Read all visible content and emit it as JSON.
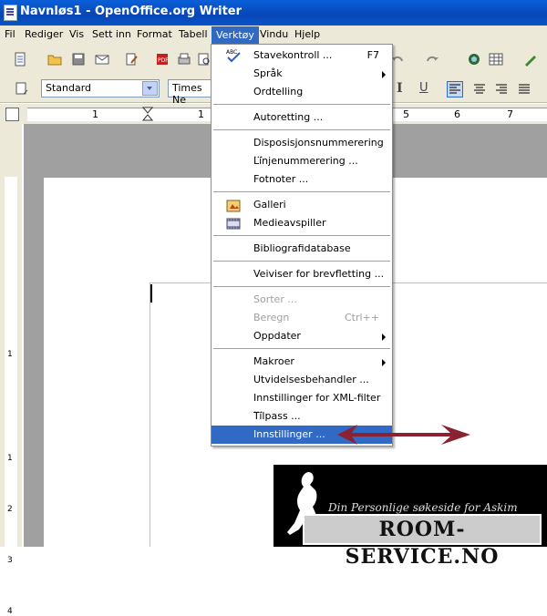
{
  "window": {
    "title": "Navnløs1 - OpenOffice.org Writer"
  },
  "menubar": {
    "items": [
      "Fil",
      "Rediger",
      "Vis",
      "Sett inn",
      "Format",
      "Tabell",
      "Verktøy",
      "Vindu",
      "Hjelp"
    ],
    "active_index": 6
  },
  "formatting": {
    "style_value": "Standard",
    "font_value": "Times Ne"
  },
  "ruler": {
    "h_labels": [
      "1",
      "1",
      "5",
      "6",
      "7"
    ],
    "v_labels": [
      "1",
      "1",
      "2",
      "3",
      "4"
    ]
  },
  "tools_menu": {
    "items": [
      {
        "label": "Stavekontroll ...",
        "accel": "F7",
        "icon": "spellcheck-icon"
      },
      {
        "label": "Språk",
        "submenu": true
      },
      {
        "label": "Ordtelling"
      },
      {
        "label": "Autoretting ..."
      },
      {
        "label": "Disposisjonsnummerering ..."
      },
      {
        "label": "Linjenummerering ..."
      },
      {
        "label": "Fotnoter ..."
      },
      {
        "label": "Galleri",
        "icon": "gallery-icon"
      },
      {
        "label": "Medieavspiller",
        "icon": "media-player-icon"
      },
      {
        "label": "Bibliografidatabase"
      },
      {
        "label": "Veiviser for brevfletting ..."
      },
      {
        "label": "Sorter ...",
        "disabled": true
      },
      {
        "label": "Beregn",
        "accel": "Ctrl++",
        "disabled": true
      },
      {
        "label": "Oppdater",
        "submenu": true
      },
      {
        "label": "Makroer",
        "submenu": true
      },
      {
        "label": "Utvidelsesbehandler ..."
      },
      {
        "label": "Innstillinger for XML-filter ..."
      },
      {
        "label": "Tilpass ..."
      },
      {
        "label": "Innstillinger ...",
        "highlighted": true
      }
    ]
  },
  "logo": {
    "slogan": "Din Personlige søkeside for Askim",
    "brand": "ROOM-SERVICE.NO"
  },
  "colors": {
    "title_bar": "#0a5fd8",
    "menu_highlight": "#316ac5",
    "arrow": "#8b2232",
    "chrome": "#ece9d8"
  }
}
